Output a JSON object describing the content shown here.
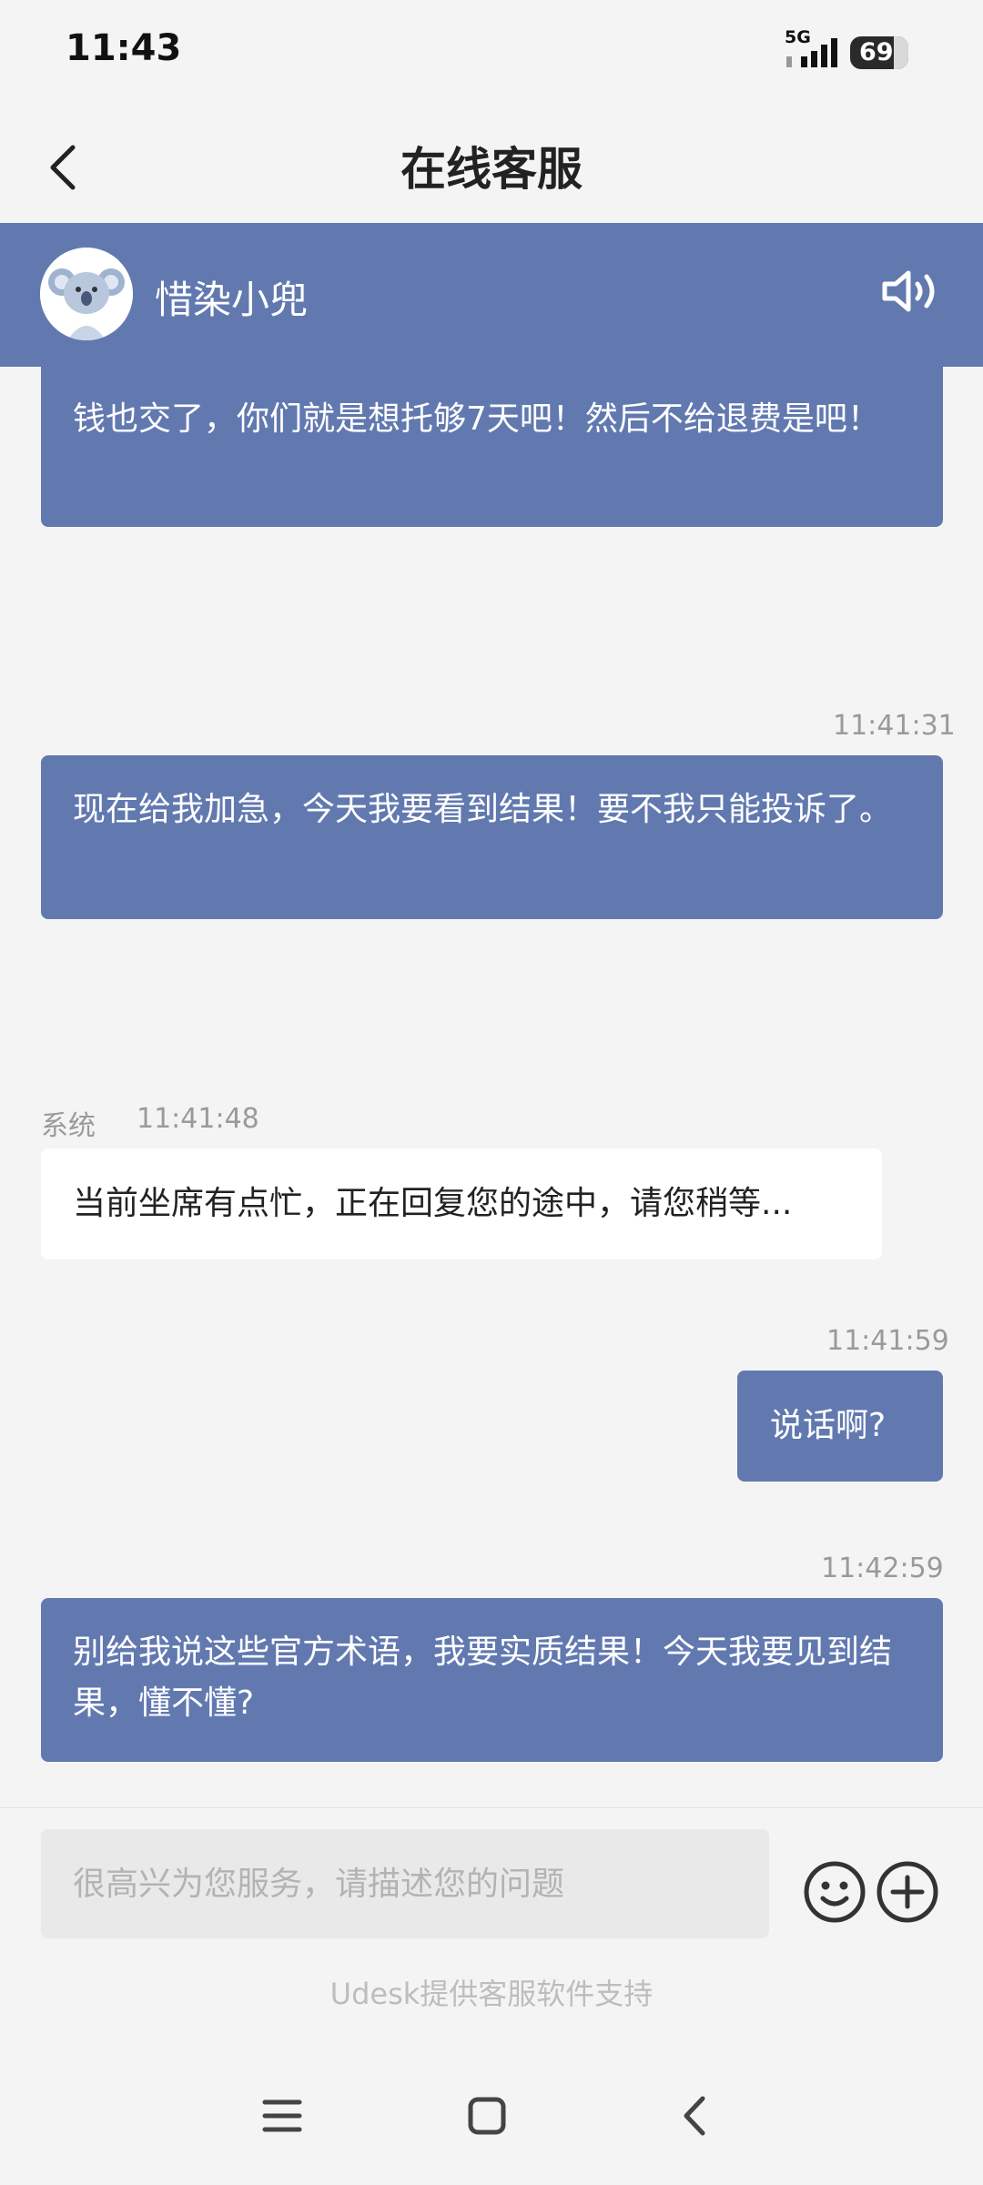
{
  "status_bar": {
    "time": "11:43",
    "network": "5G",
    "battery": "69",
    "battery_level_percent": 69,
    "icons": [
      "signal-icon",
      "battery-icon"
    ]
  },
  "header": {
    "title": "在线客服",
    "back_icon": "chevron-left-icon"
  },
  "agent": {
    "name": "惜染小兜",
    "avatar_icon": "koala-avatar-icon",
    "speaker_icon": "speaker-icon",
    "accent_color": "#6279b0"
  },
  "messages": [
    {
      "direction": "outgoing",
      "time": "",
      "text": "钱也交了，你们就是想托够7天吧！然后不给退费是吧！"
    },
    {
      "direction": "outgoing",
      "time": "11:41:31",
      "text": "现在给我加急，今天我要看到结果！要不我只能投诉了。"
    },
    {
      "direction": "incoming",
      "sender": "系统",
      "time": "11:41:48",
      "text": "当前坐席有点忙，正在回复您的途中，请您稍等..."
    },
    {
      "direction": "outgoing",
      "time": "11:41:59",
      "text": "说话啊?"
    },
    {
      "direction": "outgoing",
      "time": "11:42:59",
      "text": "别给我说这些官方术语，我要实质结果！今天我要见到结果，懂不懂?"
    }
  ],
  "input": {
    "placeholder": "很高兴为您服务，请描述您的问题",
    "value": "",
    "emoji_icon": "smiley-icon",
    "add_icon": "plus-circle-icon"
  },
  "footer": {
    "powered_by": "Udesk提供客服软件支持"
  },
  "nav_bar": {
    "icons": [
      "menu-icon",
      "home-icon",
      "back-icon"
    ]
  }
}
